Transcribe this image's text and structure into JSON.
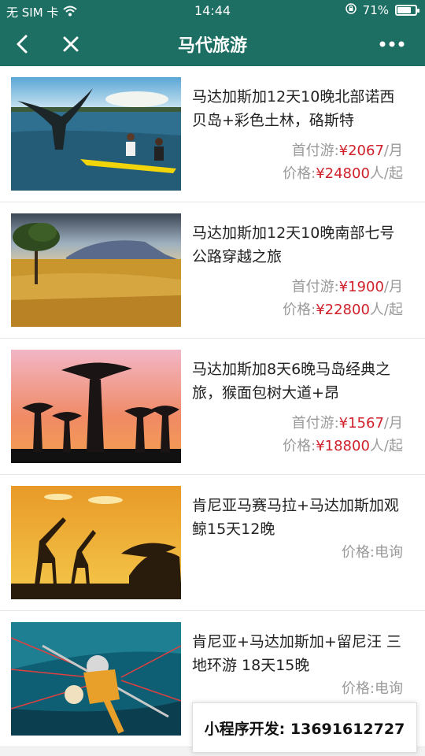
{
  "status_bar": {
    "carrier": "无 SIM 卡",
    "time": "14:44",
    "battery": "71%",
    "battery_level": 0.71
  },
  "header": {
    "title": "马代旅游"
  },
  "items": [
    {
      "name": "马达加斯加12天10晚北部诺西贝岛+彩色土林，硌斯特",
      "price1_label": "首付游:",
      "price1_value": "¥2067",
      "price1_suffix": "/月",
      "price2_label": "价格:",
      "price2_value": "¥24800",
      "price2_suffix": "人/起"
    },
    {
      "name": "马达加斯加12天10晚南部七号公路穿越之旅",
      "price1_label": "首付游:",
      "price1_value": "¥1900",
      "price1_suffix": "/月",
      "price2_label": "价格:",
      "price2_value": "¥22800",
      "price2_suffix": "人/起"
    },
    {
      "name": "马达加斯加8天6晚马岛经典之旅，猴面包树大道+昂",
      "price1_label": "首付游:",
      "price1_value": "¥1567",
      "price1_suffix": "/月",
      "price2_label": "价格:",
      "price2_value": "¥18800",
      "price2_suffix": "人/起"
    },
    {
      "name": "肯尼亚马赛马拉+马达加斯加观鲸15天12晚",
      "price2_label": "价格:",
      "price2_value": "电询"
    },
    {
      "name": "肯尼亚+马达加斯加+留尼汪 三地环游 18天15晚",
      "price2_label": "价格:",
      "price2_value": "电询"
    }
  ],
  "watermark": "小程序开发:  13691612727",
  "colors": {
    "header_bg": "#1e6f63",
    "price_red": "#d0202a",
    "muted": "#9a9a9a"
  }
}
